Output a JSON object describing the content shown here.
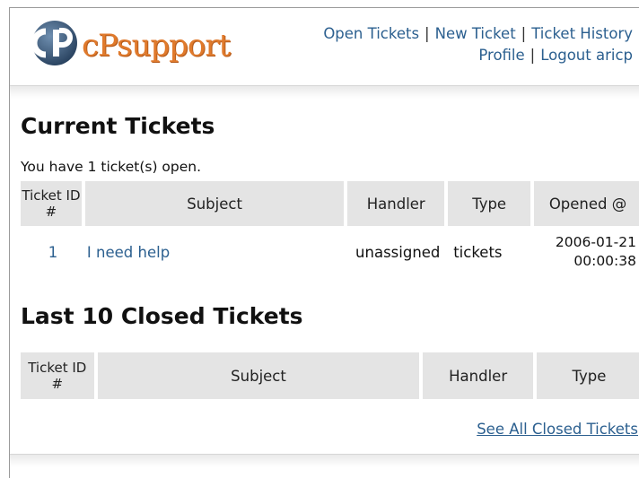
{
  "brand": {
    "logo_text": "cPsupport"
  },
  "nav": {
    "open_tickets": "Open Tickets",
    "new_ticket": "New Ticket",
    "ticket_history": "Ticket History",
    "profile": "Profile",
    "logout": "Logout aricp",
    "separator": "|"
  },
  "current": {
    "heading": "Current Tickets",
    "info": "You have 1 ticket(s) open.",
    "columns": {
      "id": "Ticket ID #",
      "subject": "Subject",
      "handler": "Handler",
      "type": "Type",
      "opened": "Opened @"
    },
    "rows": [
      {
        "id": "1",
        "subject": "I need help",
        "handler": "unassigned",
        "type": "tickets",
        "opened_date": "2006-01-21",
        "opened_time": "00:00:38"
      }
    ]
  },
  "closed": {
    "heading": "Last 10 Closed Tickets",
    "columns": {
      "id": "Ticket ID #",
      "subject": "Subject",
      "handler": "Handler",
      "type": "Type"
    },
    "see_all": "See All Closed Tickets"
  },
  "colors": {
    "link": "#2b5f8f",
    "brand_orange": "#e07a2c",
    "header_bg": "#e4e4e4"
  }
}
